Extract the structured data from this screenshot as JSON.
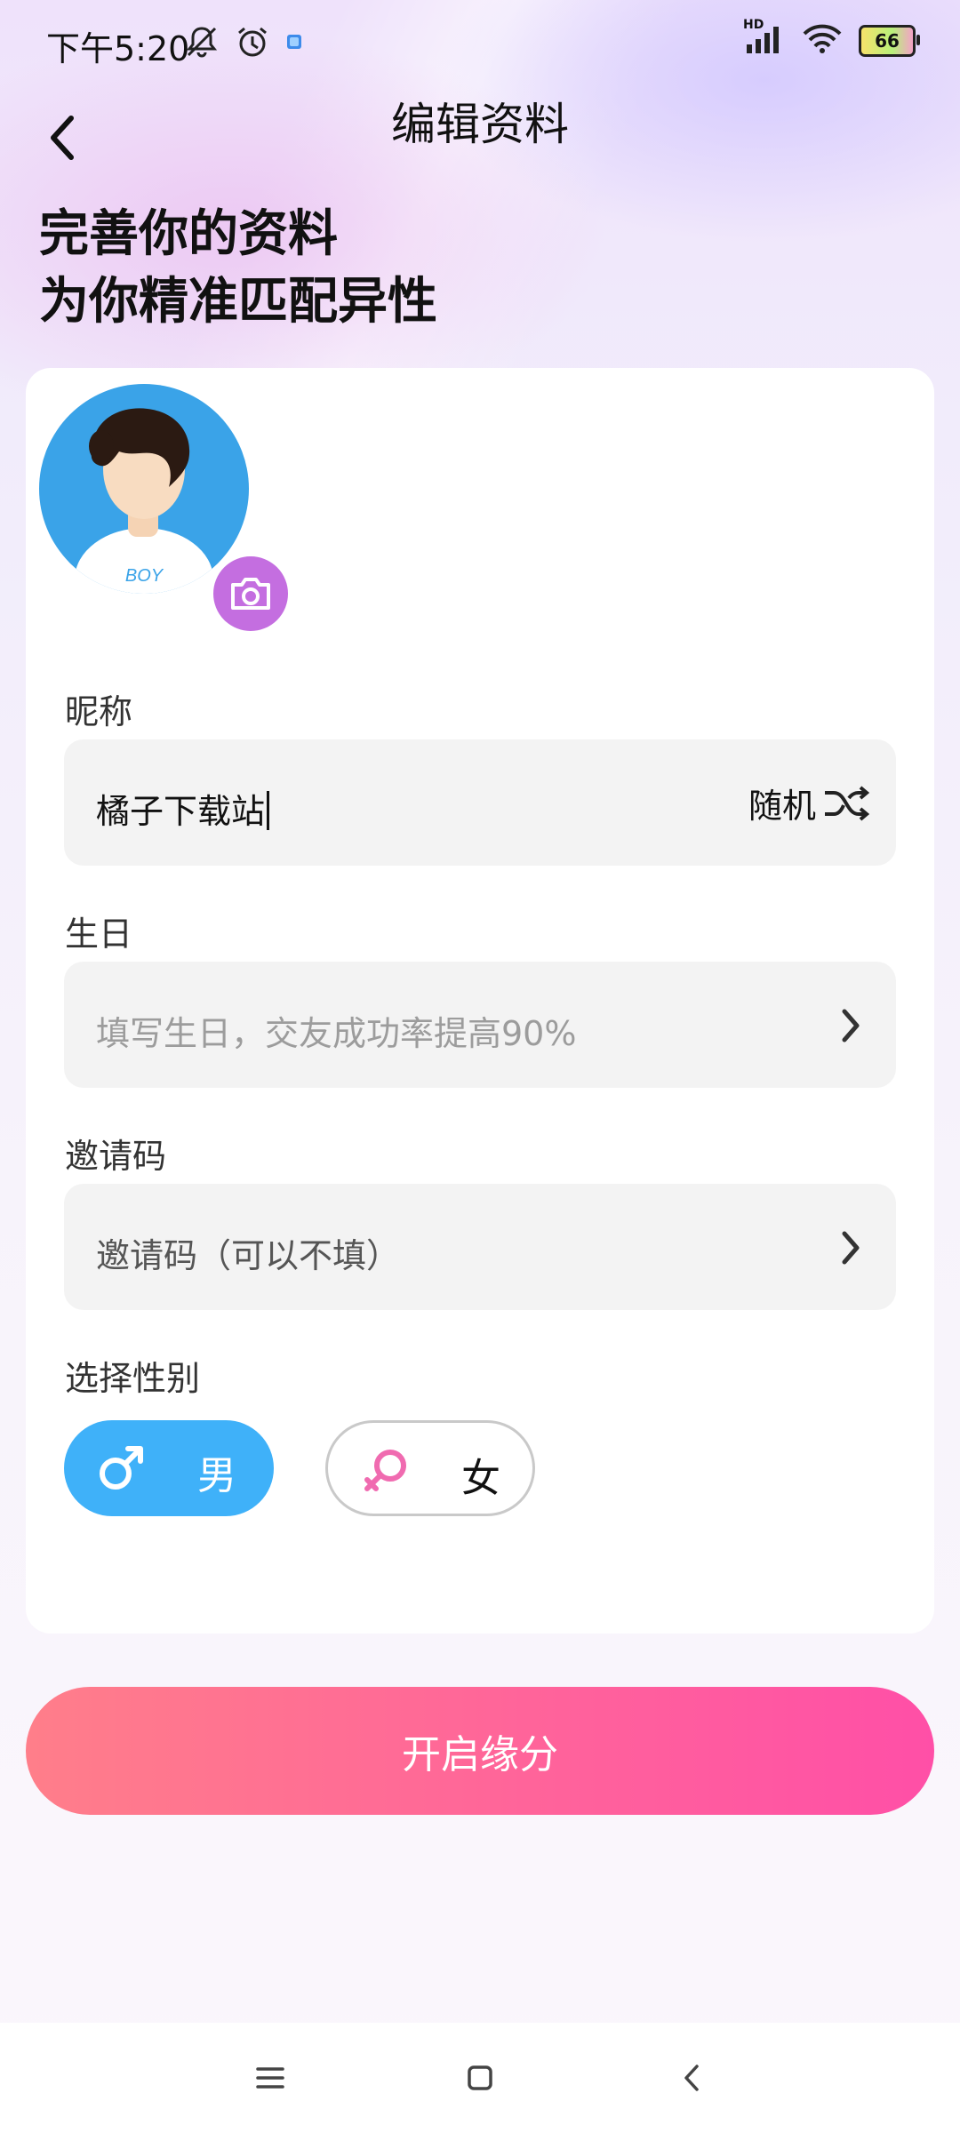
{
  "status_bar": {
    "time": "下午5:20",
    "network_label": "HD",
    "battery_level": "66",
    "icons": [
      "bell-muted-icon",
      "alarm-icon",
      "notification-dot-icon",
      "signal-icon",
      "wifi-icon",
      "battery-icon"
    ]
  },
  "nav": {
    "title": "编辑资料",
    "back_icon": "chevron-left-icon"
  },
  "headline": {
    "line1": "完善你的资料",
    "line2": "为你精准匹配异性"
  },
  "avatar": {
    "shirt_text": "BOY",
    "badge_icon": "camera-icon"
  },
  "form": {
    "nickname": {
      "label": "昵称",
      "value": "橘子下载站",
      "random_label": "随机",
      "random_icon": "shuffle-icon"
    },
    "birthday": {
      "label": "生日",
      "placeholder": "填写生日，交友成功率提高90%"
    },
    "invite_code": {
      "label": "邀请码",
      "placeholder": "邀请码（可以不填）"
    },
    "gender": {
      "label": "选择性别",
      "male": "男",
      "female": "女",
      "selected": "男",
      "male_color": "#3fb1f9",
      "female_icon_color": "#f06bb0"
    }
  },
  "submit": {
    "label": "开启缘分",
    "gradient": [
      "#ff7e8a",
      "#ff4fa7"
    ]
  },
  "system_nav": {
    "icons": [
      "menu-icon",
      "home-icon",
      "back-icon"
    ]
  }
}
